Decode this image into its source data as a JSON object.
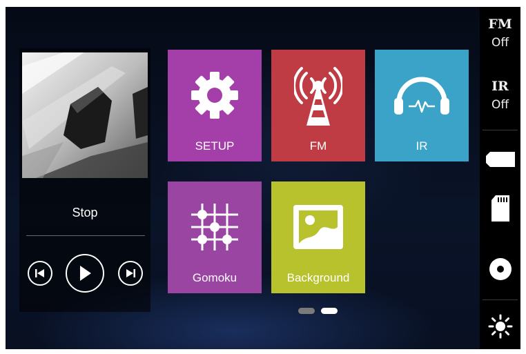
{
  "player": {
    "status": "Stop",
    "controls": {
      "prev": "skip-previous-icon",
      "play": "play-icon",
      "next": "skip-next-icon"
    }
  },
  "tiles": [
    {
      "label": "SETUP",
      "icon": "gear-icon",
      "color": "#a43ea9"
    },
    {
      "label": "FM",
      "icon": "radio-tower-icon",
      "color": "#c03c44"
    },
    {
      "label": "IR",
      "icon": "headphones-icon",
      "color": "#3aa3c7"
    },
    {
      "label": "Gomoku",
      "icon": "gomoku-board-icon",
      "color": "#9a45a2"
    },
    {
      "label": "Background",
      "icon": "image-icon",
      "color": "#b7c22c"
    }
  ],
  "pager": {
    "pages": 2,
    "current": 2,
    "colors": {
      "inactive": "#7a7a7a",
      "active": "#ffffff"
    }
  },
  "sidebar": {
    "fm_label": "FM",
    "fm_value": "Off",
    "ir_label": "IR",
    "ir_value": "Off",
    "icons": [
      "usb-icon",
      "sd-card-icon",
      "disc-icon",
      "brightness-icon"
    ]
  }
}
